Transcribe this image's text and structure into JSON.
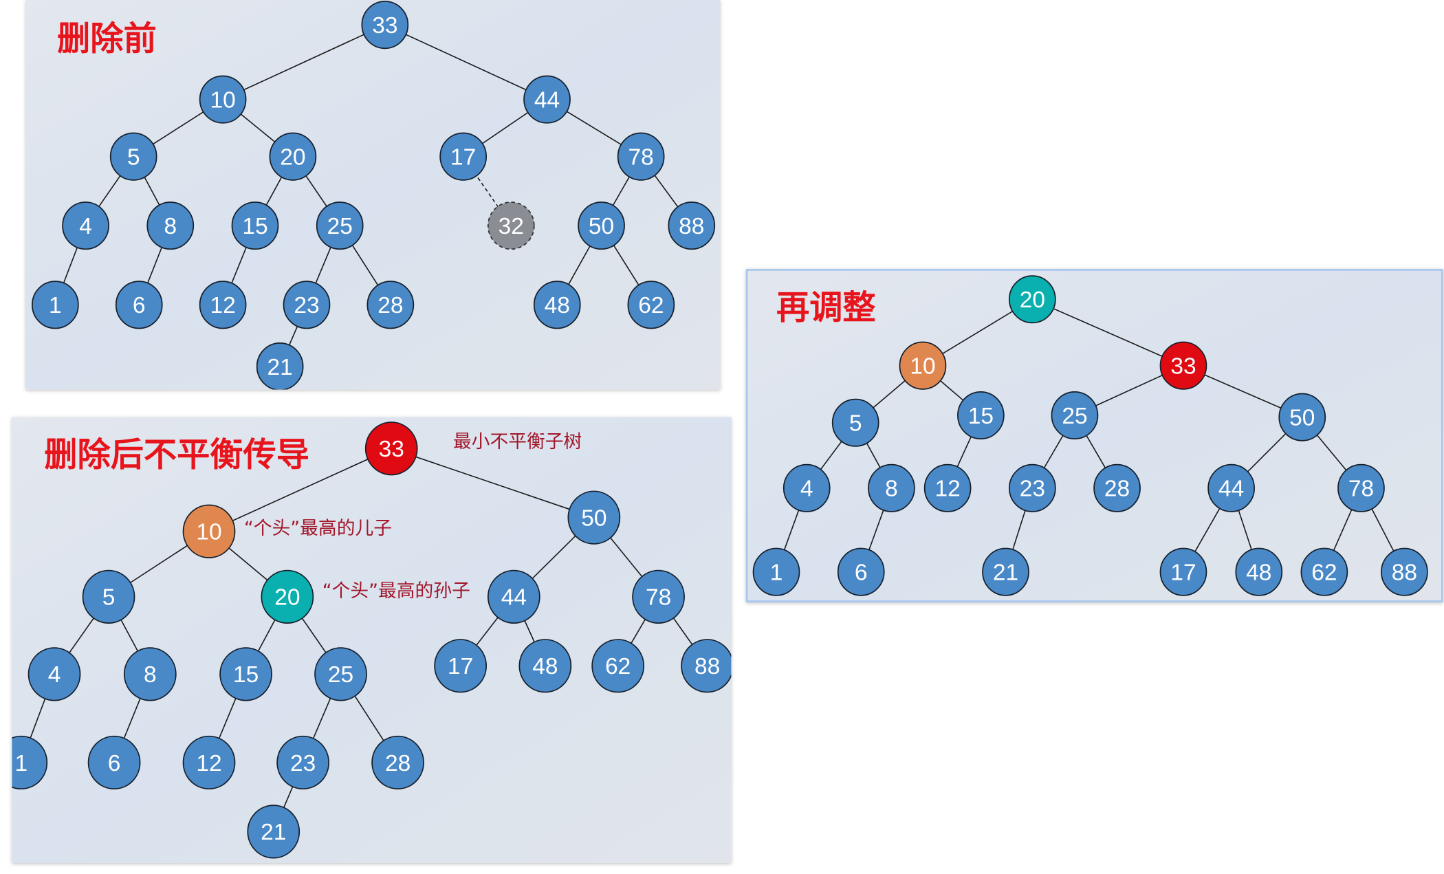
{
  "colors": {
    "normal": "#4a89c8",
    "deleted": "#8a8e94",
    "unbalanced_root": "#e00a12",
    "tallest_child": "#e0874f",
    "tallest_grandchild": "#0aafaf",
    "title": "#e8141c",
    "note": "#a3162a"
  },
  "panels": [
    {
      "id": "before",
      "title": "删除前",
      "notes": [],
      "nodes": [
        {
          "v": "33",
          "role": "normal"
        },
        {
          "v": "10",
          "role": "normal"
        },
        {
          "v": "44",
          "role": "normal"
        },
        {
          "v": "5",
          "role": "normal"
        },
        {
          "v": "20",
          "role": "normal"
        },
        {
          "v": "17",
          "role": "normal"
        },
        {
          "v": "78",
          "role": "normal"
        },
        {
          "v": "4",
          "role": "normal"
        },
        {
          "v": "8",
          "role": "normal"
        },
        {
          "v": "15",
          "role": "normal"
        },
        {
          "v": "25",
          "role": "normal"
        },
        {
          "v": "32",
          "role": "deleted"
        },
        {
          "v": "50",
          "role": "normal"
        },
        {
          "v": "88",
          "role": "normal"
        },
        {
          "v": "1",
          "role": "normal"
        },
        {
          "v": "6",
          "role": "normal"
        },
        {
          "v": "12",
          "role": "normal"
        },
        {
          "v": "23",
          "role": "normal"
        },
        {
          "v": "28",
          "role": "normal"
        },
        {
          "v": "48",
          "role": "normal"
        },
        {
          "v": "62",
          "role": "normal"
        },
        {
          "v": "21",
          "role": "normal"
        }
      ],
      "edges": [
        [
          "33",
          "10"
        ],
        [
          "33",
          "44"
        ],
        [
          "10",
          "5"
        ],
        [
          "10",
          "20"
        ],
        [
          "44",
          "17"
        ],
        [
          "44",
          "78"
        ],
        [
          "5",
          "4"
        ],
        [
          "5",
          "8"
        ],
        [
          "20",
          "15"
        ],
        [
          "20",
          "25"
        ],
        [
          "17",
          "32",
          "dashed"
        ],
        [
          "78",
          "50"
        ],
        [
          "78",
          "88"
        ],
        [
          "4",
          "1"
        ],
        [
          "8",
          "6"
        ],
        [
          "15",
          "12"
        ],
        [
          "25",
          "23"
        ],
        [
          "25",
          "28"
        ],
        [
          "50",
          "48"
        ],
        [
          "50",
          "62"
        ],
        [
          "23",
          "21"
        ]
      ]
    },
    {
      "id": "after-delete",
      "title": "删除后不平衡传导",
      "notes": [
        "最小不平衡子树",
        "“个头”最高的儿子",
        "“个头”最高的孙子"
      ],
      "nodes": [
        {
          "v": "33",
          "role": "unbalanced_root"
        },
        {
          "v": "10",
          "role": "tallest_child"
        },
        {
          "v": "50",
          "role": "normal"
        },
        {
          "v": "5",
          "role": "normal"
        },
        {
          "v": "20",
          "role": "tallest_grandchild"
        },
        {
          "v": "44",
          "role": "normal"
        },
        {
          "v": "78",
          "role": "normal"
        },
        {
          "v": "4",
          "role": "normal"
        },
        {
          "v": "8",
          "role": "normal"
        },
        {
          "v": "15",
          "role": "normal"
        },
        {
          "v": "25",
          "role": "normal"
        },
        {
          "v": "17",
          "role": "normal"
        },
        {
          "v": "48",
          "role": "normal"
        },
        {
          "v": "62",
          "role": "normal"
        },
        {
          "v": "88",
          "role": "normal"
        },
        {
          "v": "1",
          "role": "normal"
        },
        {
          "v": "6",
          "role": "normal"
        },
        {
          "v": "12",
          "role": "normal"
        },
        {
          "v": "23",
          "role": "normal"
        },
        {
          "v": "28",
          "role": "normal"
        },
        {
          "v": "21",
          "role": "normal"
        }
      ],
      "edges": [
        [
          "33",
          "10"
        ],
        [
          "33",
          "50"
        ],
        [
          "10",
          "5"
        ],
        [
          "10",
          "20"
        ],
        [
          "50",
          "44"
        ],
        [
          "50",
          "78"
        ],
        [
          "5",
          "4"
        ],
        [
          "5",
          "8"
        ],
        [
          "20",
          "15"
        ],
        [
          "20",
          "25"
        ],
        [
          "44",
          "17"
        ],
        [
          "44",
          "48"
        ],
        [
          "78",
          "62"
        ],
        [
          "78",
          "88"
        ],
        [
          "4",
          "1"
        ],
        [
          "8",
          "6"
        ],
        [
          "15",
          "12"
        ],
        [
          "25",
          "23"
        ],
        [
          "25",
          "28"
        ],
        [
          "23",
          "21"
        ]
      ]
    },
    {
      "id": "readjusted",
      "title": "再调整",
      "notes": [],
      "nodes": [
        {
          "v": "20",
          "role": "tallest_grandchild"
        },
        {
          "v": "10",
          "role": "tallest_child"
        },
        {
          "v": "33",
          "role": "unbalanced_root"
        },
        {
          "v": "5",
          "role": "normal"
        },
        {
          "v": "15",
          "role": "normal"
        },
        {
          "v": "25",
          "role": "normal"
        },
        {
          "v": "50",
          "role": "normal"
        },
        {
          "v": "4",
          "role": "normal"
        },
        {
          "v": "8",
          "role": "normal"
        },
        {
          "v": "12",
          "role": "normal"
        },
        {
          "v": "23",
          "role": "normal"
        },
        {
          "v": "28",
          "role": "normal"
        },
        {
          "v": "44",
          "role": "normal"
        },
        {
          "v": "78",
          "role": "normal"
        },
        {
          "v": "1",
          "role": "normal"
        },
        {
          "v": "6",
          "role": "normal"
        },
        {
          "v": "21",
          "role": "normal"
        },
        {
          "v": "17",
          "role": "normal"
        },
        {
          "v": "48",
          "role": "normal"
        },
        {
          "v": "62",
          "role": "normal"
        },
        {
          "v": "88",
          "role": "normal"
        }
      ],
      "edges": [
        [
          "20",
          "10"
        ],
        [
          "20",
          "33"
        ],
        [
          "10",
          "5"
        ],
        [
          "10",
          "15"
        ],
        [
          "33",
          "25"
        ],
        [
          "33",
          "50"
        ],
        [
          "5",
          "4"
        ],
        [
          "5",
          "8"
        ],
        [
          "15",
          "12"
        ],
        [
          "25",
          "23"
        ],
        [
          "25",
          "28"
        ],
        [
          "50",
          "44"
        ],
        [
          "50",
          "78"
        ],
        [
          "4",
          "1"
        ],
        [
          "8",
          "6"
        ],
        [
          "23",
          "21"
        ],
        [
          "44",
          "17"
        ],
        [
          "44",
          "48"
        ],
        [
          "78",
          "62"
        ],
        [
          "78",
          "88"
        ]
      ]
    }
  ]
}
